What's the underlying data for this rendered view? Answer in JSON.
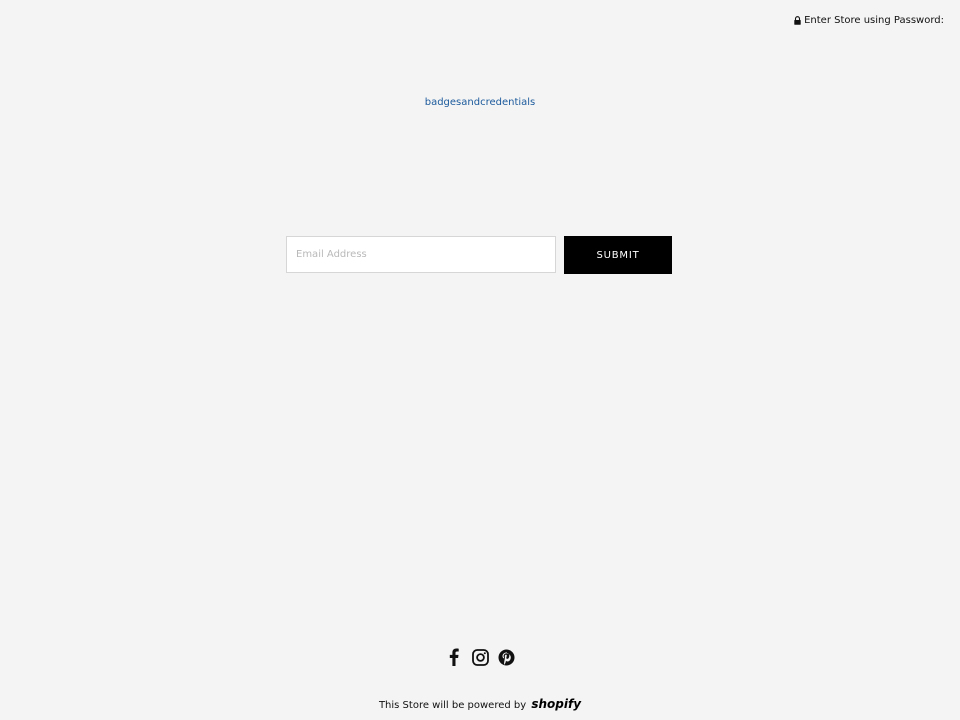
{
  "header": {
    "password_link_label": "Enter Store using Password:",
    "lock_icon": "lock-icon"
  },
  "store": {
    "name": "badgesandcredentials",
    "link_color": "#1c5a9c"
  },
  "signup": {
    "email_placeholder": "Email Address",
    "email_value": "",
    "submit_label": "SUBMIT"
  },
  "social": {
    "icons": [
      "facebook-icon",
      "instagram-icon",
      "pinterest-icon"
    ]
  },
  "footer": {
    "powered_by_text": "This Store will be powered by",
    "shopify_logo_text": "shopify"
  },
  "colors": {
    "background": "#f4f4f4",
    "button": "#000000",
    "button_text": "#ffffff"
  }
}
